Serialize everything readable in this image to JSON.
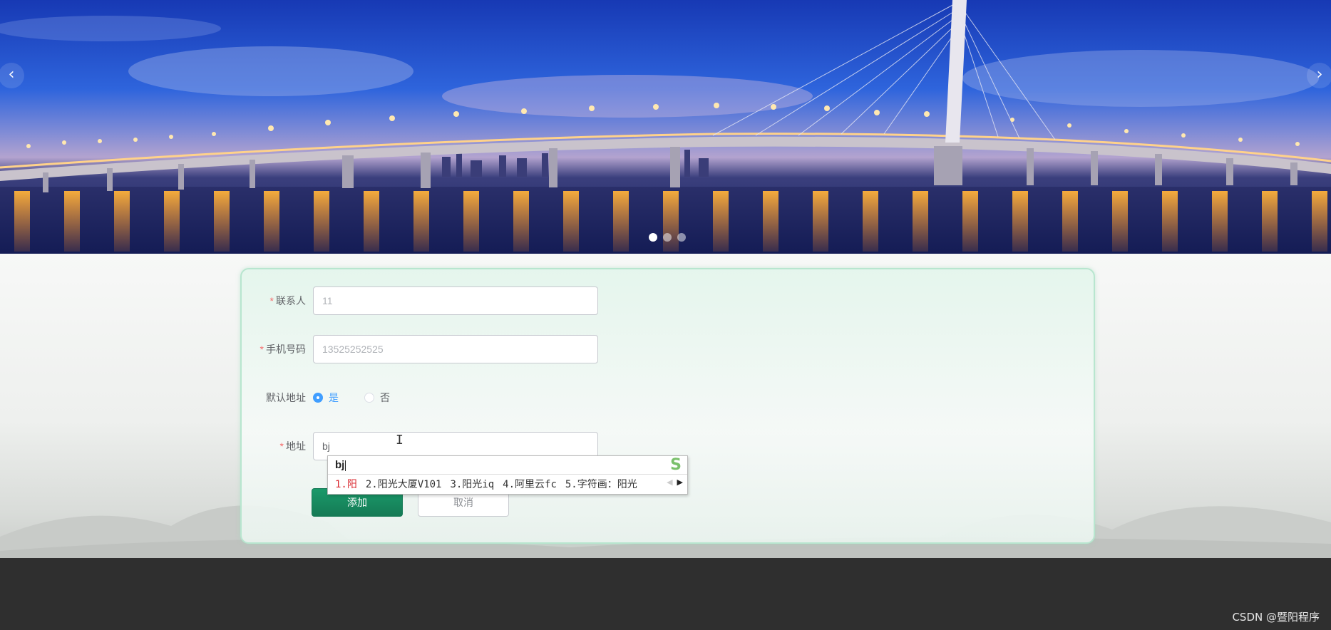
{
  "carousel": {
    "prev_icon": "chevron-left-icon",
    "next_icon": "chevron-right-icon",
    "prev_glyph": "‹",
    "next_glyph": "›",
    "slide_count": 3,
    "active_slide": 1
  },
  "form": {
    "contact": {
      "label": "联系人",
      "required": true,
      "value": "",
      "placeholder": "11"
    },
    "phone": {
      "label": "手机号码",
      "required": true,
      "value": "",
      "placeholder": "13525252525"
    },
    "default_address": {
      "label": "默认地址",
      "options": [
        {
          "label": "是",
          "checked": true
        },
        {
          "label": "否",
          "checked": false
        }
      ]
    },
    "address": {
      "label": "地址",
      "required": true,
      "value": "bj",
      "placeholder": ""
    },
    "required_mark": "*",
    "submit_label": "添加",
    "cancel_label": "取消"
  },
  "ime": {
    "composition": "bj",
    "candidates": [
      "1.阳",
      "2.阳光大厦V101",
      "3.阳光iq",
      "4.阿里云fc",
      "5.字符画：阳光"
    ],
    "logo_glyph": "S",
    "prev_glyph": "◀",
    "next_glyph": "▶"
  },
  "cursor_glyph": "I",
  "footer": {
    "watermark": "CSDN @暨阳程序"
  },
  "colors": {
    "accent": "#409eff",
    "primary_button": "#157a55",
    "card_border": "#b8e6cf",
    "footer_bg": "#2f2f2f",
    "required": "#f56c6c"
  }
}
